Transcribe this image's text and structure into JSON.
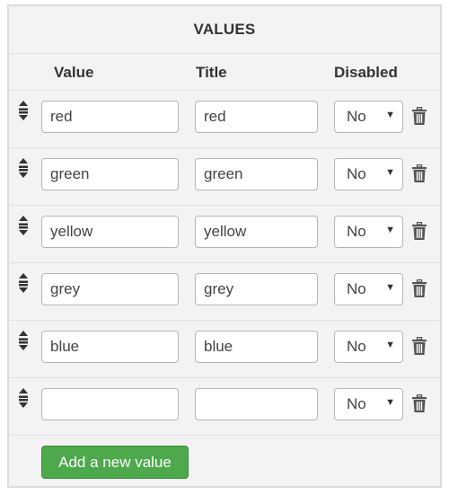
{
  "panel": {
    "title": "VALUES"
  },
  "columns": {
    "value": "Value",
    "title": "Title",
    "disabled": "Disabled"
  },
  "rows": [
    {
      "value": "red",
      "title": "red",
      "disabled": "No"
    },
    {
      "value": "green",
      "title": "green",
      "disabled": "No"
    },
    {
      "value": "yellow",
      "title": "yellow",
      "disabled": "No"
    },
    {
      "value": "grey",
      "title": "grey",
      "disabled": "No"
    },
    {
      "value": "blue",
      "title": "blue",
      "disabled": "No"
    },
    {
      "value": "",
      "title": "",
      "disabled": "No"
    }
  ],
  "icons": {
    "drag": "drag-handle-icon",
    "delete": "trash-icon",
    "dropdown": "caret-down-icon"
  },
  "actions": {
    "add_label": "Add a new value"
  },
  "colors": {
    "add_button": "#4ea84c",
    "panel_bg": "#f3f3f3",
    "border": "#dcdcdc"
  }
}
